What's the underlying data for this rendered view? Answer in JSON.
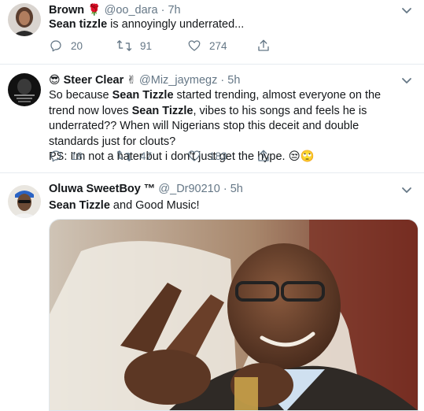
{
  "colors": {
    "text": "#14171a",
    "muted": "#657786",
    "divider": "#e6ecf0"
  },
  "tweets": [
    {
      "name": "Brown",
      "name_emoji": "🌹",
      "handle": "@oo_dara",
      "separator": "·",
      "time": "7h",
      "text_parts": [
        "Sean tizzle",
        " is annoyingly underrated..."
      ],
      "stats": {
        "replies": "20",
        "retweets": "91",
        "likes": "274"
      }
    },
    {
      "name_emoji_pre": "😎",
      "name": "Steer Clear",
      "name_emoji": "✌",
      "handle": "@Miz_jaymegz",
      "separator": "·",
      "time": "5h",
      "text_parts": [
        "So because ",
        "Sean Tizzle",
        " started trending, almost everyone on the trend now loves ",
        "Sean Tizzle",
        ", vibes to his songs and feels he is underrated?? When will Nigerians stop this deceit and double standards just for clouts?",
        "PS: I'm not a hater but i don't just get the hype. 😒🙄"
      ],
      "stats": {
        "replies": "18",
        "retweets": "47",
        "likes": "183"
      }
    },
    {
      "name": "Oluwa SweetBoy ™",
      "handle": "@_Dr90210",
      "separator": "·",
      "time": "5h",
      "text_parts": [
        "Sean Tizzle",
        " and Good Music!"
      ],
      "media": {
        "kind": "photo",
        "subject": "smiling man pointing with both hands"
      }
    }
  ],
  "icons": {
    "reply": "reply-icon",
    "retweet": "retweet-icon",
    "like": "heart-icon",
    "share": "share-icon",
    "more": "chevron-down-icon"
  }
}
